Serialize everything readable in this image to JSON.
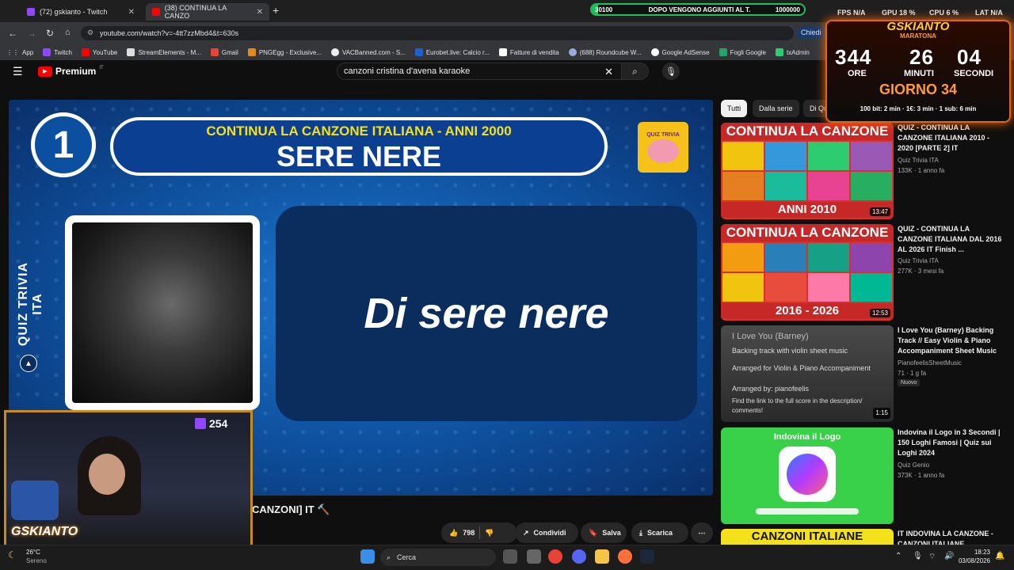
{
  "tabs": [
    {
      "label": "(72) gskianto - Twitch"
    },
    {
      "label": "(38) CONTINUA LA CANZO"
    }
  ],
  "overlay": {
    "left_value": "30100",
    "text": "DOPO VENGONO AGGIUNTI AL T.",
    "right_value": "1000000",
    "progress": 0.03
  },
  "stats": {
    "fps_label": "FPS",
    "fps": "N/A",
    "gpu_label": "GPU",
    "gpu": "18 %",
    "cpu_label": "CPU",
    "cpu": "6 %",
    "lat_label": "LAT",
    "lat": "N/A"
  },
  "address": {
    "url": "youtube.com/watch?v=-4tt7zzMbd4&t=630s",
    "chiedi": "Chiedi"
  },
  "bookmarks": [
    "App",
    "Twitch",
    "YouTube",
    "StreamElements - M...",
    "Gmail",
    "PNGEgg - Exclusive...",
    "VACBanned.com - S...",
    "Eurobet.live: Calcio r...",
    "Fatture di vendita",
    "(688) Roundcube W...",
    "Google AdSense",
    "Fogli Google",
    "txAdmin"
  ],
  "youtube": {
    "brand": "Premium",
    "brand_sup": "IT",
    "search_value": "canzoni cristina d'avena karaoke"
  },
  "video": {
    "number": "1",
    "banner_line1": "CONTINUA LA CANZONE ITALIANA - ANNI 2000",
    "banner_line2": "SERE NERE",
    "side_text": "QUIZ TRIVIA ITA",
    "lyric": "Di sere nere",
    "logo_text": "QUIZ TRIVIA"
  },
  "video_title_partial": "CANZONI] IT",
  "actions": {
    "likes": "798",
    "share": "Condividi",
    "save": "Salva",
    "download": "Scarica"
  },
  "chips": [
    "Tutti",
    "Dalla serie",
    "Di Qu"
  ],
  "recommendations": [
    {
      "thumb_top": "CONTINUA LA CANZONE",
      "thumb_bottom": "ANNI 2010",
      "duration": "13:47",
      "title": "QUIZ - CONTINUA LA CANZONE ITALIANA 2010 - 2020 [PARTE 2] IT",
      "channel": "Quiz Trivia ITA",
      "meta": "133K · 1 anno fa"
    },
    {
      "thumb_top": "CONTINUA LA CANZONE",
      "thumb_bottom": "2016 - 2026",
      "duration": "12:53",
      "title": "QUIZ - CONTINUA LA CANZONE ITALIANA DAL 2016 AL 2026 IT Finish ...",
      "channel": "Quiz Trivia ITA",
      "meta": "277K · 3 mesi fa"
    },
    {
      "thumb_lines": [
        "I Love You (Barney)",
        "Backing track with violin sheet music",
        "Arranged for Violin & Piano Accompaniment",
        "Arranged by: pianofeelis",
        "Find the link to the full score in the description/ comments!"
      ],
      "duration": "1:15",
      "title": "I Love You (Barney) Backing Track // Easy Violin & Piano Accompaniment Sheet Music",
      "channel": "PianofeelisSheetMusic",
      "meta": "71 · 1 g fa",
      "badge": "Nuovo"
    },
    {
      "thumb_top": "Indovina il Logo",
      "title": "Indovina il Logo in 3 Secondi | 150 Loghi Famosi | Quiz sui Loghi 2024",
      "channel": "Quiz Genio",
      "meta": "373K · 1 anno fa"
    },
    {
      "thumb_top": "CANZONI ITALIANE",
      "title": "IT INDOVINA LA CANZONE - CANZONI ITALIANE"
    }
  ],
  "timer": {
    "title": "GSKIANTO",
    "subtitle": "MARATONA",
    "hours": "344",
    "hours_label": "ORE",
    "minutes": "26",
    "minutes_label": "MINUTI",
    "seconds": "04",
    "seconds_label": "SECONDI",
    "day": "GIORNO 34",
    "rules": "100 bit: 2 min · 1€: 3 min · 1 sub: 6 min"
  },
  "cam": {
    "viewer_count": "254",
    "brand": "GSKIANTO"
  },
  "taskbar": {
    "weather_temp": "26°C",
    "weather_desc": "Sereno",
    "search": "Cerca",
    "time": "18:23",
    "date": "03/08/2026"
  },
  "colors": {
    "accent_green": "#1fbf5a",
    "yt_red": "#ff0000",
    "banner_yellow": "#f4e11b",
    "timer_orange": "#e0651a"
  }
}
